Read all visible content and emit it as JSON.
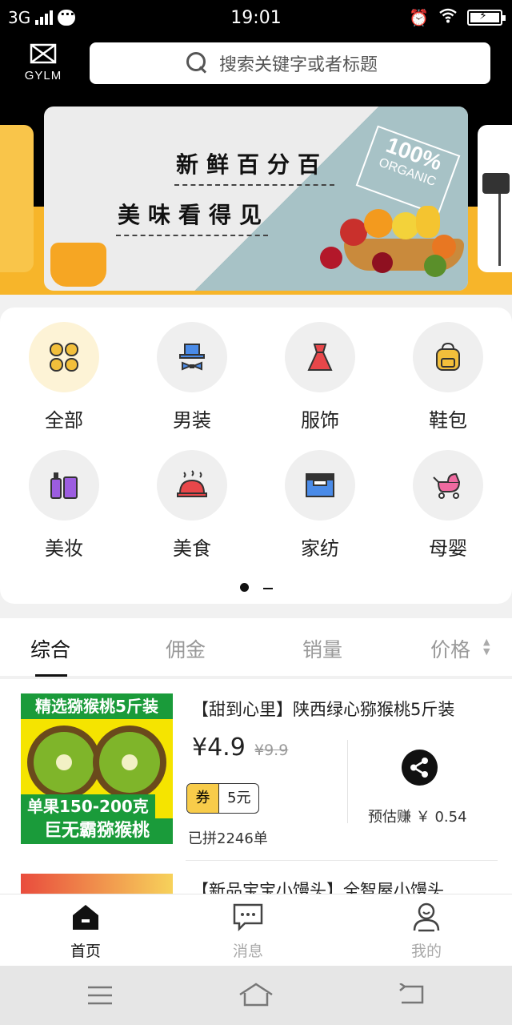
{
  "status_bar": {
    "network": "3G",
    "time": "19:01"
  },
  "header": {
    "logo_text": "GYLM",
    "search_placeholder": "搜索关键字或者标题"
  },
  "banner": {
    "line1": [
      "新",
      "鲜",
      "百",
      "分",
      "百"
    ],
    "line2": [
      "美",
      "味",
      "看",
      "得",
      "见"
    ],
    "badge_big": "100%",
    "badge_small": "ORGANIC"
  },
  "categories": [
    {
      "label": "全部",
      "icon": "grid-icon"
    },
    {
      "label": "男装",
      "icon": "hat-bowtie-icon"
    },
    {
      "label": "服饰",
      "icon": "dress-icon"
    },
    {
      "label": "鞋包",
      "icon": "backpack-icon"
    },
    {
      "label": "美妆",
      "icon": "cosmetics-icon"
    },
    {
      "label": "美食",
      "icon": "food-dish-icon"
    },
    {
      "label": "家纺",
      "icon": "bedding-icon"
    },
    {
      "label": "母婴",
      "icon": "stroller-icon"
    }
  ],
  "tabs": [
    {
      "label": "综合",
      "active": true
    },
    {
      "label": "佣金",
      "active": false
    },
    {
      "label": "销量",
      "active": false
    },
    {
      "label": "价格",
      "active": false
    }
  ],
  "products": [
    {
      "title": "【甜到心里】陕西绿心猕猴桃5斤装",
      "price": "¥4.9",
      "original_price": "¥9.9",
      "coupon_label": "券",
      "coupon_value": "5元",
      "sold": "已拼2246单",
      "estimate": "预估赚 ￥ 0.54",
      "image": {
        "top_text": "精选猕猴桃5斤装",
        "weight_text": "单果150-200克",
        "bottom_text": "巨无霸猕猴桃"
      }
    },
    {
      "title": "【新品宝宝小馒头】全智屋小馒头"
    }
  ],
  "bottom_nav": [
    {
      "label": "首页",
      "icon": "home-icon",
      "active": true
    },
    {
      "label": "消息",
      "icon": "message-icon",
      "active": false
    },
    {
      "label": "我的",
      "icon": "profile-icon",
      "active": false
    }
  ]
}
